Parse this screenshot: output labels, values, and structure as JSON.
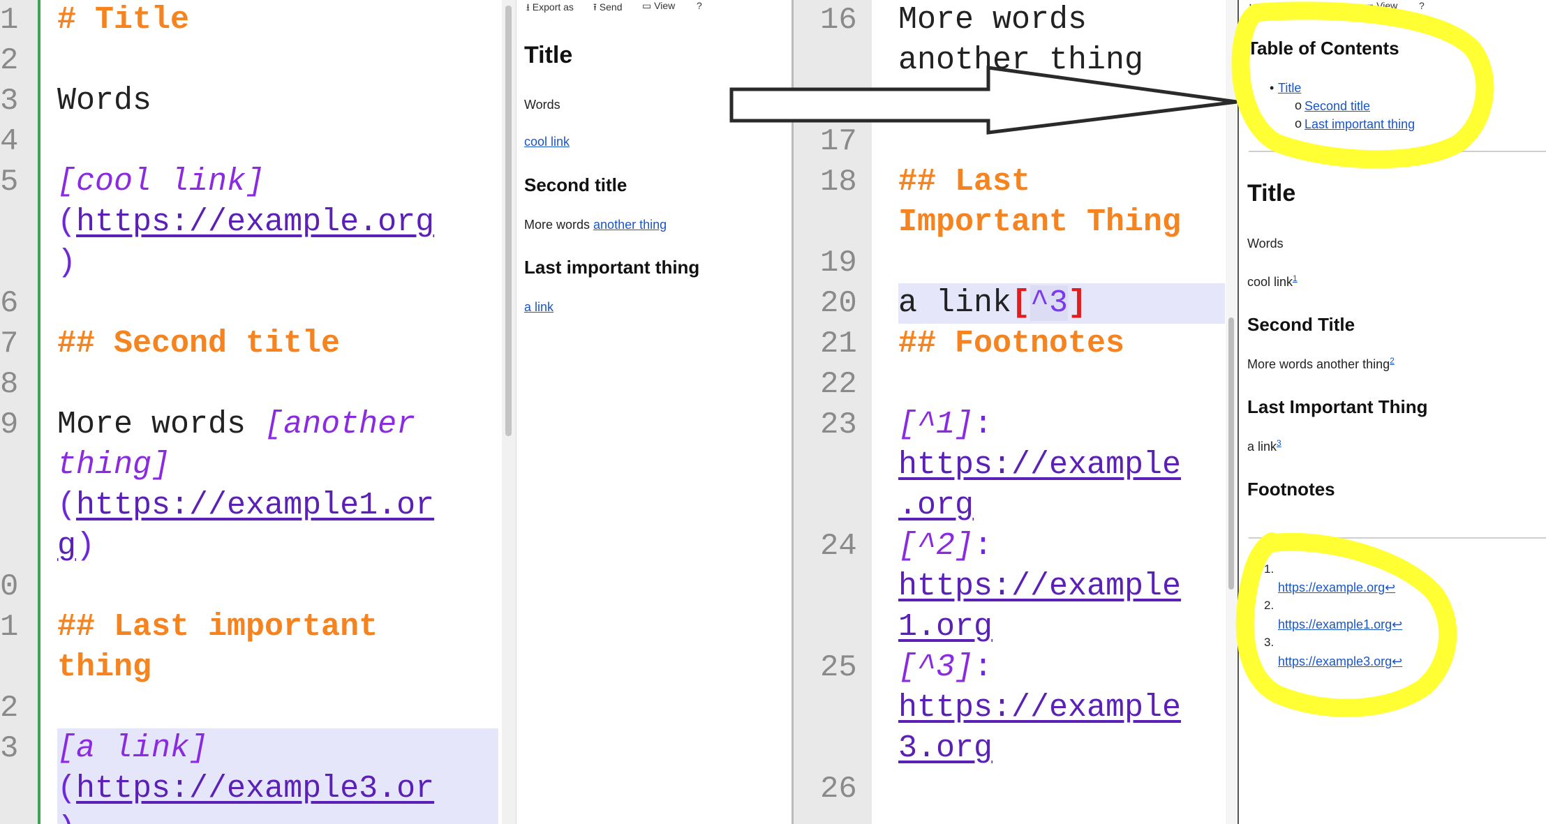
{
  "editor_left": {
    "gutter_numbers": [
      "1",
      "2",
      "3",
      "4",
      "5",
      "6",
      "7",
      "8",
      "9",
      "0",
      "1",
      "2",
      "3"
    ],
    "lines": {
      "l1": "# Title",
      "l3": "Words",
      "l5_text": "[cool link]",
      "l5_open": "(",
      "l5_url": "https://example.org",
      "l5_close": ")",
      "l7": "## Second title",
      "l9_plain": "More words ",
      "l9_text_a": "[another",
      "l9_text_b": "thing]",
      "l9_open": "(",
      "l9_url_a": "https://example1.or",
      "l9_url_b": "g",
      "l9_close": ")",
      "l11_a": "## Last important",
      "l11_b": "thing",
      "l13_text": "[a link]",
      "l13_open": "(",
      "l13_url": "https://example3.or",
      "l13_tail": ")"
    }
  },
  "preview_left": {
    "toolbar": {
      "export": "Export as",
      "send": "Send",
      "view": "View",
      "help": "?"
    },
    "title": "Title",
    "words": "Words",
    "cool_link": "cool link",
    "second_title": "Second title",
    "more_words": "More words ",
    "another_thing": "another thing",
    "last_title": "Last important thing",
    "a_link": "a link"
  },
  "editor_right": {
    "gutter_numbers": [
      "16",
      "17",
      "18",
      "19",
      "20",
      "21",
      "22",
      "23",
      "24",
      "25",
      "26"
    ],
    "lines": {
      "l16_a": "More words",
      "l16_b": "another thing",
      "l18_a": "## Last",
      "l18_b": "Important Thing",
      "l20_plain": "a link",
      "l20_open": "[",
      "l20_ref": "^3",
      "l20_close": "]",
      "l21": "## Footnotes",
      "l23_label": "[^1]",
      "l23_colon": ":",
      "l23_url_a": "https://example",
      "l23_url_b": ".org",
      "l24_label": "[^2]",
      "l24_colon": ":",
      "l24_url_a": "https://example",
      "l24_url_b": "1.org",
      "l25_label": "[^3]",
      "l25_colon": ":",
      "l25_url_a": "https://example",
      "l25_url_b": "3.org"
    }
  },
  "preview_right": {
    "toolbar": {
      "export": "Export as",
      "send": "Send",
      "view": "View",
      "help": "?"
    },
    "toc_heading": "Table of Contents",
    "toc": [
      "Title",
      "Second title",
      "Last important thing"
    ],
    "title": "Title",
    "words": "Words",
    "cool_link": "cool link",
    "sup1": "1",
    "second_title": "Second Title",
    "more_words": "More words another thing",
    "sup2": "2",
    "last_title": "Last Important Thing",
    "a_link": "a link",
    "sup3": "3",
    "footnotes_heading": "Footnotes",
    "footnote_numbers": [
      "1.",
      "2.",
      "3."
    ],
    "footnotes": [
      "https://example.org↩",
      "https://example1.org↩",
      "https://example3.org↩"
    ]
  },
  "colors": {
    "heading": "#f5831f",
    "link_text": "#8a2be2",
    "url": "#5b21b6",
    "highlight": "#e6e6fa",
    "preview_link": "#1a56c4",
    "annotation": "#ffff33"
  }
}
